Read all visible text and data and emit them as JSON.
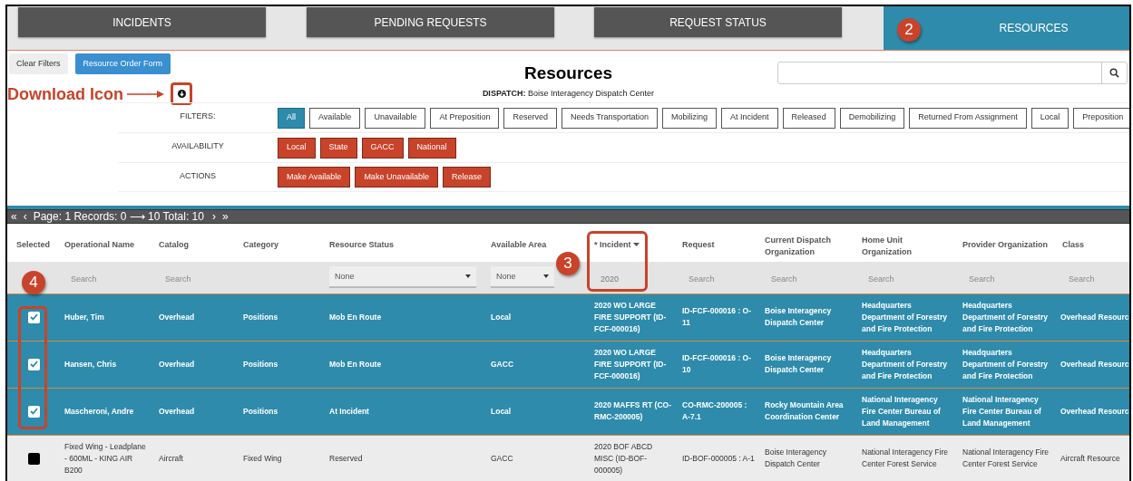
{
  "tabs": [
    {
      "label": "INCIDENTS",
      "selected": false
    },
    {
      "label": "PENDING REQUESTS",
      "selected": false
    },
    {
      "label": "REQUEST STATUS",
      "selected": false
    },
    {
      "label": "RESOURCES",
      "selected": true
    }
  ],
  "toolbar": [
    {
      "label": "Clear Filters",
      "kind": "secondary"
    },
    {
      "label": "Resource Order Form",
      "kind": "primary"
    }
  ],
  "title": "Resources",
  "dispatch": "**DISPATCH:** Boise Interagency Dispatch Center",
  "filter_groups": [
    {
      "label": "FILTERS:",
      "kind": "toggle",
      "options": [
        {
          "label": "All",
          "selected": true
        },
        {
          "label": "Available",
          "selected": false
        },
        {
          "label": "Unavailable",
          "selected": false
        },
        {
          "label": "At Preposition",
          "selected": false
        },
        {
          "label": "Reserved",
          "selected": false
        },
        {
          "label": "Needs Transportation",
          "selected": false
        },
        {
          "label": "Mobilizing",
          "selected": false
        },
        {
          "label": "At Incident",
          "selected": false
        },
        {
          "label": "Released",
          "selected": false
        },
        {
          "label": "Demobilizing",
          "selected": false
        },
        {
          "label": "Returned From Assignment",
          "selected": false
        },
        {
          "label": "Local",
          "selected": false
        },
        {
          "label": "Preposition",
          "selected": false
        }
      ]
    },
    {
      "label": "AVAILABILITY",
      "kind": "action",
      "options": [
        {
          "label": "Local"
        },
        {
          "label": "State"
        },
        {
          "label": "GACC"
        },
        {
          "label": "National"
        }
      ]
    },
    {
      "label": "ACTIONS",
      "kind": "action",
      "options": [
        {
          "label": "Make Available"
        },
        {
          "label": "Make Unavailable"
        },
        {
          "label": "Release"
        }
      ]
    }
  ],
  "pager": {
    "first": "«",
    "prev": "‹",
    "text": "Page: 1 Records: 0 ⟶ 10 Total: 10",
    "next": "›",
    "last": "»"
  },
  "table": {
    "columns": [
      {
        "label": "Selected",
        "sorted": false
      },
      {
        "label": "Operational Name",
        "sorted": false
      },
      {
        "label": "Catalog",
        "sorted": false
      },
      {
        "label": "Category",
        "sorted": false
      },
      {
        "label": "Resource Status",
        "sorted": false
      },
      {
        "label": "Available Area",
        "sorted": false
      },
      {
        "label": "* Incident",
        "sorted": true
      },
      {
        "label": "Request",
        "sorted": false
      },
      {
        "label": "Current Dispatch Organization",
        "sorted": false
      },
      {
        "label": "Home Unit Organization",
        "sorted": false
      },
      {
        "label": "Provider Organization",
        "sorted": false
      },
      {
        "label": "Class",
        "sorted": false
      }
    ],
    "filters": [
      {
        "kind": "blank"
      },
      {
        "kind": "search",
        "placeholder": "Search"
      },
      {
        "kind": "search",
        "placeholder": "Search"
      },
      {
        "kind": "blank"
      },
      {
        "kind": "select",
        "value": "None"
      },
      {
        "kind": "select",
        "value": "None"
      },
      {
        "kind": "search",
        "value": "2020"
      },
      {
        "kind": "search",
        "placeholder": "Search"
      },
      {
        "kind": "search",
        "placeholder": "Search"
      },
      {
        "kind": "search",
        "placeholder": "Search"
      },
      {
        "kind": "search",
        "placeholder": "Search"
      },
      {
        "kind": "search",
        "placeholder": "Search"
      }
    ],
    "rows": [
      {
        "selected": true,
        "cells": [
          "",
          "Huber, Tim",
          "Overhead",
          "Positions",
          "Mob En Route",
          "Local",
          "2020 WO LARGE FIRE SUPPORT (ID-FCF-000016)",
          "ID-FCF-000016 : O-11",
          "Boise Interagency Dispatch Center",
          "Headquarters Department of Forestry and Fire Protection",
          "Headquarters Department of Forestry and Fire Protection",
          "Overhead Resourc"
        ]
      },
      {
        "selected": true,
        "cells": [
          "",
          "Hansen, Chris",
          "Overhead",
          "Positions",
          "Mob En Route",
          "GACC",
          "2020 WO LARGE FIRE SUPPORT (ID-FCF-000016)",
          "ID-FCF-000016 : O-10",
          "Boise Interagency Dispatch Center",
          "Headquarters Department of Forestry and Fire Protection",
          "Headquarters Department of Forestry and Fire Protection",
          "Overhead Resourc"
        ]
      },
      {
        "selected": true,
        "cells": [
          "",
          "Mascheroni, Andre",
          "Overhead",
          "Positions",
          "At Incident",
          "Local",
          "2020 MAFFS RT (CO-RMC-200005)",
          "CO-RMC-200005 : A-7.1",
          "Rocky Mountain Area Coordination Center",
          "National Interagency Fire Center Bureau of Land Management",
          "National Interagency Fire Center Bureau of Land Management",
          "Overhead Resourc"
        ]
      },
      {
        "selected": false,
        "cells": [
          "",
          "Fixed Wing - Leadplane - 600ML - KING AIR B200",
          "Aircraft",
          "Fixed Wing",
          "Reserved",
          "GACC",
          "2020 BOF ABCD MISC (ID-BOF-000005)",
          "ID-BOF-000005 : A-1",
          "Boise Interagency Dispatch Center",
          "National Interagency Fire Center Forest Service",
          "National Interagency Fire Center Forest Service",
          "Aircraft Resource"
        ]
      }
    ]
  },
  "annotations": {
    "download_label": "Download Icon",
    "badges": [
      "2",
      "3",
      "4"
    ]
  }
}
